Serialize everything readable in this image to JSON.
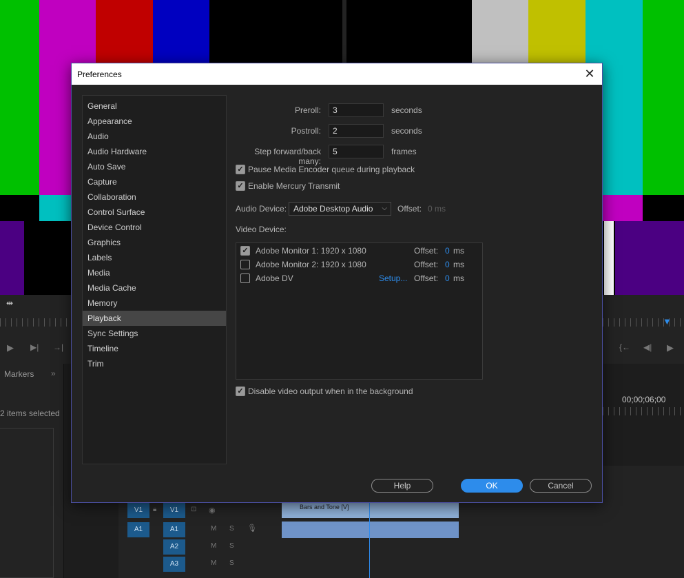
{
  "dialog": {
    "title": "Preferences",
    "close_icon": "close-icon"
  },
  "nav": {
    "items": [
      {
        "label": "General"
      },
      {
        "label": "Appearance"
      },
      {
        "label": "Audio"
      },
      {
        "label": "Audio Hardware"
      },
      {
        "label": "Auto Save"
      },
      {
        "label": "Capture"
      },
      {
        "label": "Collaboration"
      },
      {
        "label": "Control Surface"
      },
      {
        "label": "Device Control"
      },
      {
        "label": "Graphics"
      },
      {
        "label": "Labels"
      },
      {
        "label": "Media"
      },
      {
        "label": "Media Cache"
      },
      {
        "label": "Memory"
      },
      {
        "label": "Playback"
      },
      {
        "label": "Sync Settings"
      },
      {
        "label": "Timeline"
      },
      {
        "label": "Trim"
      }
    ],
    "selected": "Playback"
  },
  "playback": {
    "preroll_label": "Preroll:",
    "preroll_value": "3",
    "preroll_unit": "seconds",
    "postroll_label": "Postroll:",
    "postroll_value": "2",
    "postroll_unit": "seconds",
    "step_label": "Step forward/back many:",
    "step_value": "5",
    "step_unit": "frames",
    "pause_encoder_label": "Pause Media Encoder queue during playback",
    "pause_encoder_checked": true,
    "mercury_label": "Enable Mercury Transmit",
    "mercury_checked": true,
    "audio_device_label": "Audio Device:",
    "audio_device_value": "Adobe Desktop Audio",
    "audio_offset_label": "Offset:",
    "audio_offset_value": "0 ms",
    "video_device_label": "Video Device:",
    "video_devices": [
      {
        "name": "Adobe Monitor 1: 1920 x 1080",
        "checked": true,
        "offset_label": "Offset:",
        "offset_value": "0",
        "offset_unit": "ms"
      },
      {
        "name": "Adobe Monitor 2: 1920 x 1080",
        "checked": false,
        "offset_label": "Offset:",
        "offset_value": "0",
        "offset_unit": "ms"
      },
      {
        "name": "Adobe DV",
        "checked": false,
        "setup_label": "Setup...",
        "offset_label": "Offset:",
        "offset_value": "0",
        "offset_unit": "ms"
      }
    ],
    "disable_output_label": "Disable video output when in the background",
    "disable_output_checked": true
  },
  "buttons": {
    "help": "Help",
    "ok": "OK",
    "cancel": "Cancel"
  },
  "background": {
    "markers_tab": "Markers",
    "items_selected": "2 items selected",
    "timecode": "00;00;06;00",
    "clip_label": "Bars and Tone [V]",
    "tracks": [
      "V1",
      "V1",
      "A1",
      "A1",
      "A2",
      "A3"
    ],
    "track_m": "M",
    "track_s": "S"
  },
  "colors": {
    "accent": "#2d8ceb",
    "dialog_bg": "#232323",
    "selected_item": "#464646"
  }
}
